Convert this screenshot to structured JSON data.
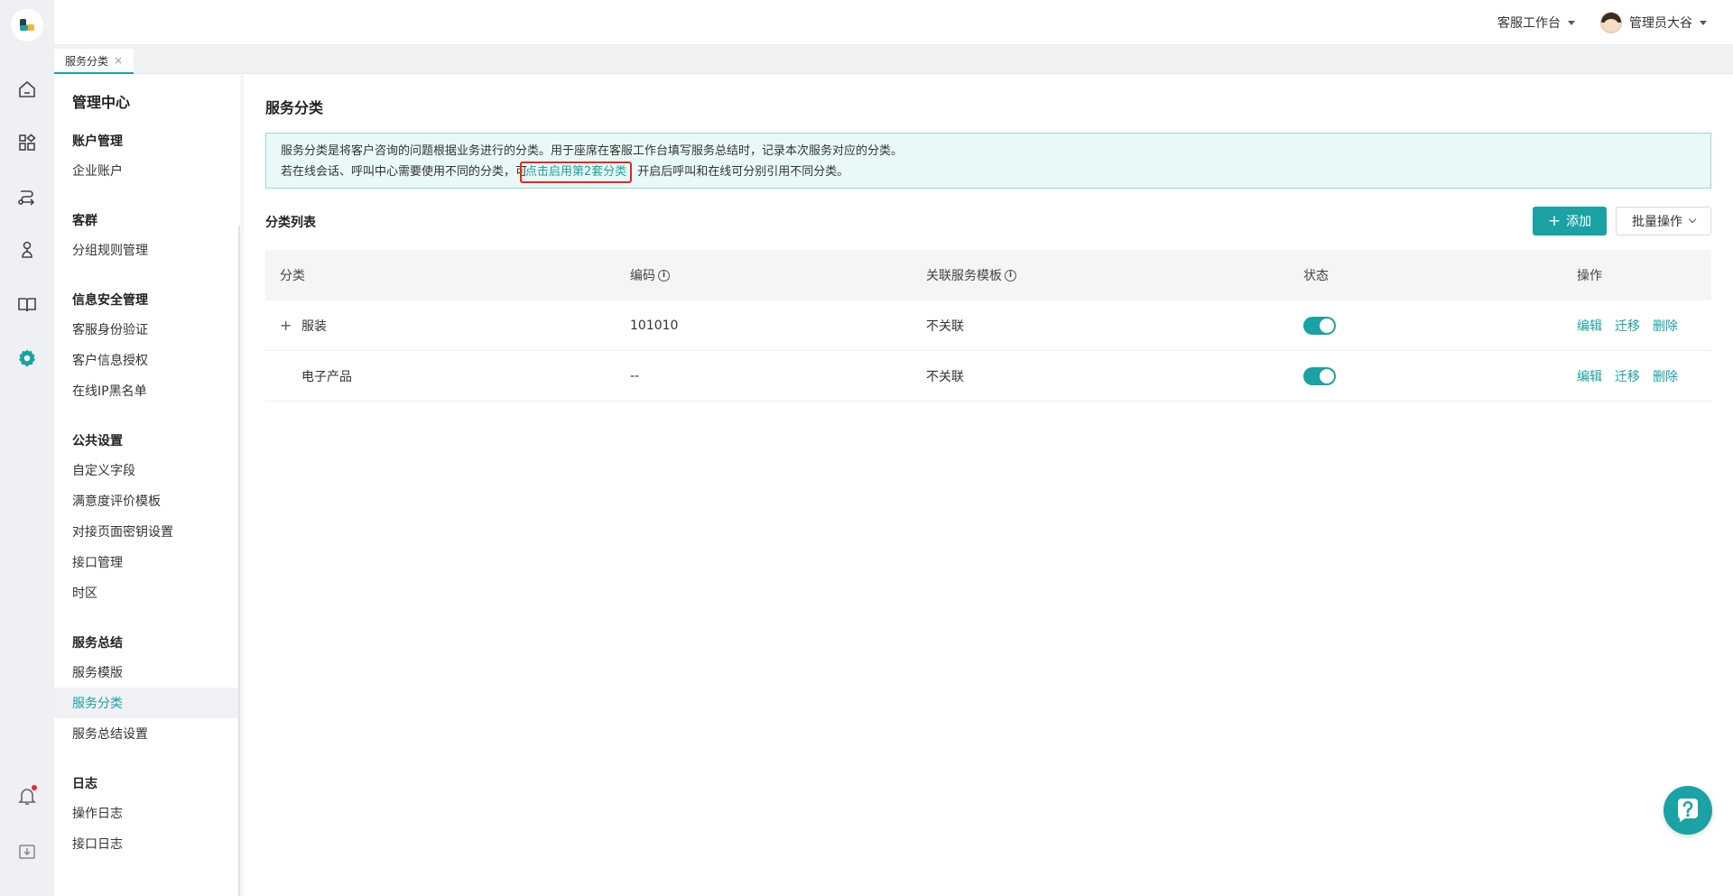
{
  "colors": {
    "accent": "#1aa2a5",
    "highlight_border": "#e8271d",
    "notice_bg": "#e9f9f7"
  },
  "header": {
    "workspace": "客服工作台",
    "user": "管理员大谷"
  },
  "tabs": [
    {
      "label": "服务分类",
      "close": "×"
    }
  ],
  "rail": {
    "icons": [
      "home-icon",
      "apps-icon",
      "route-icon",
      "user-tree-icon",
      "book-icon",
      "gear-icon",
      "bell-icon",
      "download-icon"
    ]
  },
  "sidebar": {
    "title": "管理中心",
    "groups": [
      {
        "title": "账户管理",
        "items": [
          "企业账户"
        ]
      },
      {
        "title": "客群",
        "items": [
          "分组规则管理"
        ]
      },
      {
        "title": "信息安全管理",
        "items": [
          "客服身份验证",
          "客户信息授权",
          "在线IP黑名单"
        ]
      },
      {
        "title": "公共设置",
        "items": [
          "自定义字段",
          "满意度评价模板",
          "对接页面密钥设置",
          "接口管理",
          "时区"
        ]
      },
      {
        "title": "服务总结",
        "items": [
          "服务模版",
          "服务分类",
          "服务总结设置"
        ]
      },
      {
        "title": "日志",
        "items": [
          "操作日志",
          "接口日志"
        ]
      }
    ],
    "active_item": "服务分类"
  },
  "main": {
    "title": "服务分类",
    "notice": {
      "line1": "服务分类是将客户咨询的问题根据业务进行的分类。用于座席在客服工作台填写服务总结时，记录本次服务对应的分类。",
      "line2_prefix": "若在线会话、呼叫中心需要使用不同的分类，可",
      "line2_link": "点击启用第2套分类",
      "line2_suffix": "开启后呼叫和在线可分别引用不同分类。"
    },
    "list_title": "分类列表",
    "add_label": "添加",
    "batch_label": "批量操作",
    "columns": [
      "分类",
      "编码",
      "关联服务模板",
      "状态",
      "操作"
    ],
    "rows": [
      {
        "expand": "+",
        "name": "服装",
        "code": "101010",
        "template": "不关联",
        "enabled": true,
        "actions": [
          "编辑",
          "迁移",
          "删除"
        ]
      },
      {
        "expand": "",
        "name": "电子产品",
        "code": "--",
        "template": "不关联",
        "enabled": true,
        "actions": [
          "编辑",
          "迁移",
          "删除"
        ]
      }
    ]
  }
}
